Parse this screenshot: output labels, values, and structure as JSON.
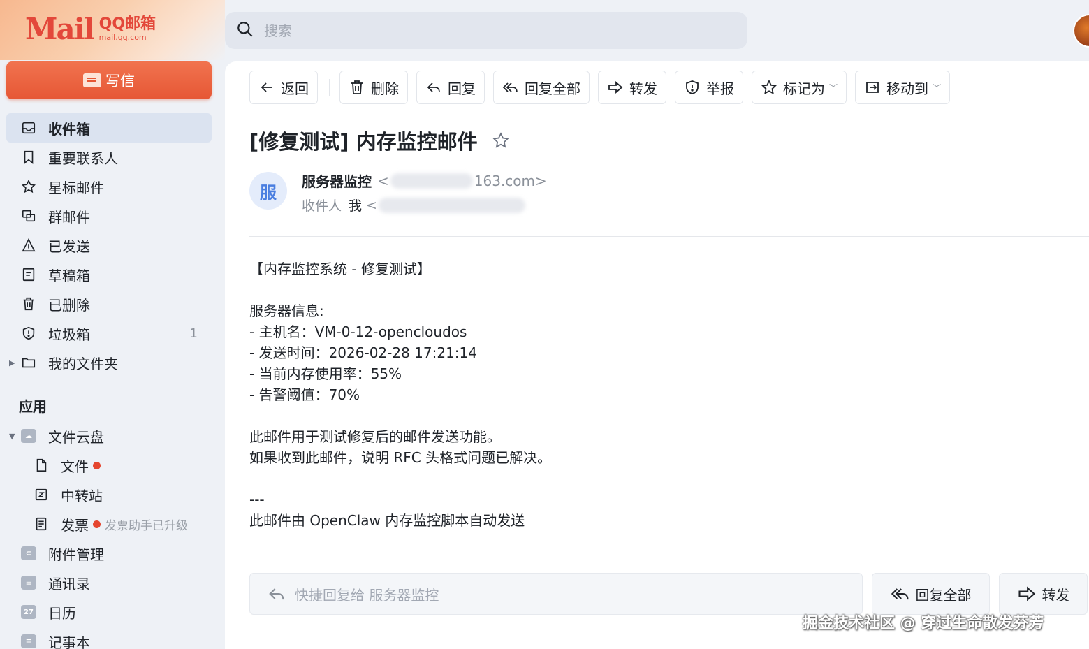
{
  "header": {
    "logo_mail": "Mail",
    "logo_name": "QQ邮箱",
    "logo_url": "mail.qq.com",
    "search_placeholder": "搜索"
  },
  "sidebar": {
    "compose_label": "写信",
    "folders": [
      {
        "label": "收件箱",
        "icon": "inbox-icon",
        "active": true
      },
      {
        "label": "重要联系人",
        "icon": "bookmark-icon"
      },
      {
        "label": "星标邮件",
        "icon": "star-icon"
      },
      {
        "label": "群邮件",
        "icon": "group-mail-icon"
      },
      {
        "label": "已发送",
        "icon": "sent-icon"
      },
      {
        "label": "草稿箱",
        "icon": "draft-icon"
      },
      {
        "label": "已删除",
        "icon": "trash-icon"
      },
      {
        "label": "垃圾箱",
        "icon": "spam-shield-icon",
        "count": "1"
      },
      {
        "label": "我的文件夹",
        "icon": "folder-icon"
      }
    ],
    "apps_title": "应用",
    "apps": [
      {
        "label": "文件云盘",
        "icon": "cloud-drive-icon"
      },
      {
        "label": "文件",
        "icon": "file-icon"
      },
      {
        "label": "中转站",
        "icon": "transfer-station-icon"
      },
      {
        "label": "发票",
        "icon": "invoice-icon",
        "hint": "发票助手已升级"
      },
      {
        "label": "附件管理",
        "icon": "attachment-icon"
      },
      {
        "label": "通讯录",
        "icon": "contacts-icon"
      },
      {
        "label": "日历",
        "icon": "calendar-icon",
        "badge": "27"
      },
      {
        "label": "记事本",
        "icon": "notebook-icon"
      }
    ]
  },
  "toolbar": {
    "back": "返回",
    "delete": "删除",
    "reply": "回复",
    "reply_all": "回复全部",
    "forward": "转发",
    "report": "举报",
    "mark_as": "标记为",
    "move_to": "移动到"
  },
  "mail": {
    "subject": "[修复测试] 内存监控邮件",
    "avatar_char": "服",
    "sender_name": "服务器监控",
    "sender_email_tail": "163.com>",
    "recipient_label": "收件人",
    "recipient_name": "我",
    "body": "【内存监控系统 - 修复测试】\n\n服务器信息:\n- 主机名：VM-0-12-opencloudos\n- 发送时间：2026-02-28 17:21:14\n- 当前内存使用率：55%\n- 告警阈值：70%\n\n此邮件用于测试修复后的邮件发送功能。\n如果收到此邮件，说明 RFC 头格式问题已解决。\n\n---\n此邮件由 OpenClaw 内存监控脚本自动发送"
  },
  "quick_reply": {
    "placeholder": "快捷回复给 服务器监控",
    "reply_all": "回复全部",
    "forward": "转发"
  },
  "watermark": "掘金技术社区 @ 穿过生命散发芬芳",
  "colors": {
    "accent": "#e65735",
    "active_bg": "#dbe3f0",
    "dot": "#e5462f"
  }
}
